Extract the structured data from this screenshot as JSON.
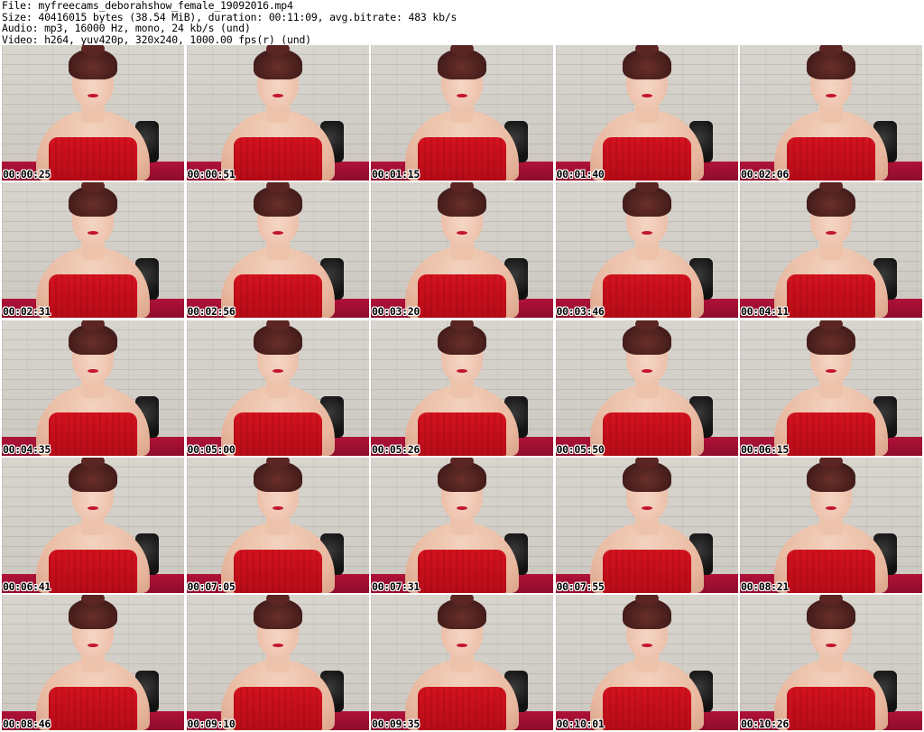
{
  "header": {
    "file_line": "File: myfreecams_deborahshow_female_19092016.mp4",
    "size_line": "Size: 40416015 bytes (38.54 MiB), duration: 00:11:09, avg.bitrate: 483 kb/s",
    "audio_line": "Audio: mp3, 16000 Hz, mono, 24 kb/s (und)",
    "video_line": "Video: h264, yuv420p, 320x240, 1000.00 fps(r) (und)"
  },
  "thumbnails": [
    {
      "timestamp": "00:00:25"
    },
    {
      "timestamp": "00:00:51"
    },
    {
      "timestamp": "00:01:15"
    },
    {
      "timestamp": "00:01:40"
    },
    {
      "timestamp": "00:02:06"
    },
    {
      "timestamp": "00:02:31"
    },
    {
      "timestamp": "00:02:56"
    },
    {
      "timestamp": "00:03:20"
    },
    {
      "timestamp": "00:03:46"
    },
    {
      "timestamp": "00:04:11"
    },
    {
      "timestamp": "00:04:35"
    },
    {
      "timestamp": "00:05:00"
    },
    {
      "timestamp": "00:05:26"
    },
    {
      "timestamp": "00:05:50"
    },
    {
      "timestamp": "00:06:15"
    },
    {
      "timestamp": "00:06:41"
    },
    {
      "timestamp": "00:07:05"
    },
    {
      "timestamp": "00:07:31"
    },
    {
      "timestamp": "00:07:55"
    },
    {
      "timestamp": "00:08:21"
    },
    {
      "timestamp": "00:08:46"
    },
    {
      "timestamp": "00:09:10"
    },
    {
      "timestamp": "00:09:35"
    },
    {
      "timestamp": "00:10:01"
    },
    {
      "timestamp": "00:10:26"
    }
  ]
}
